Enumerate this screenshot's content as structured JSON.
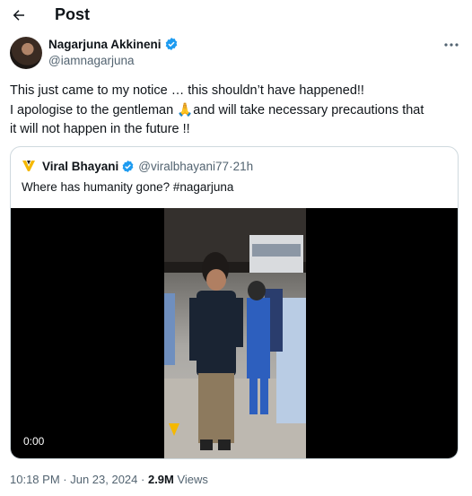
{
  "header": {
    "title": "Post",
    "back_icon": "arrow-left-icon"
  },
  "author": {
    "name": "Nagarjuna Akkineni",
    "handle": "@iamnagarjuna",
    "verified": true,
    "verified_color": "#1d9bf0"
  },
  "tweet": {
    "line1": "This just came to my notice … this shouldn’t have happened!!",
    "line2_a": "I apologise to the gentleman ",
    "emoji": "🙏",
    "line2_b": "and will take necessary precautions that",
    "line3": "it will not happen in the future !!"
  },
  "quote": {
    "name": "Viral Bhayani",
    "handle": "@viralbhayani77",
    "separator": " · ",
    "time": "21h",
    "text": "Where has humanity gone? #nagarjuna",
    "video_time": "0:00",
    "logo_color": "#f5b800"
  },
  "meta": {
    "time": "10:18 PM",
    "sep1": " · ",
    "date": "Jun 23, 2024",
    "sep2": " · ",
    "views_count": "2.9M",
    "views_label": " Views"
  },
  "colors": {
    "text": "#0f1419",
    "secondary": "#536471",
    "border": "#cfd9de"
  }
}
